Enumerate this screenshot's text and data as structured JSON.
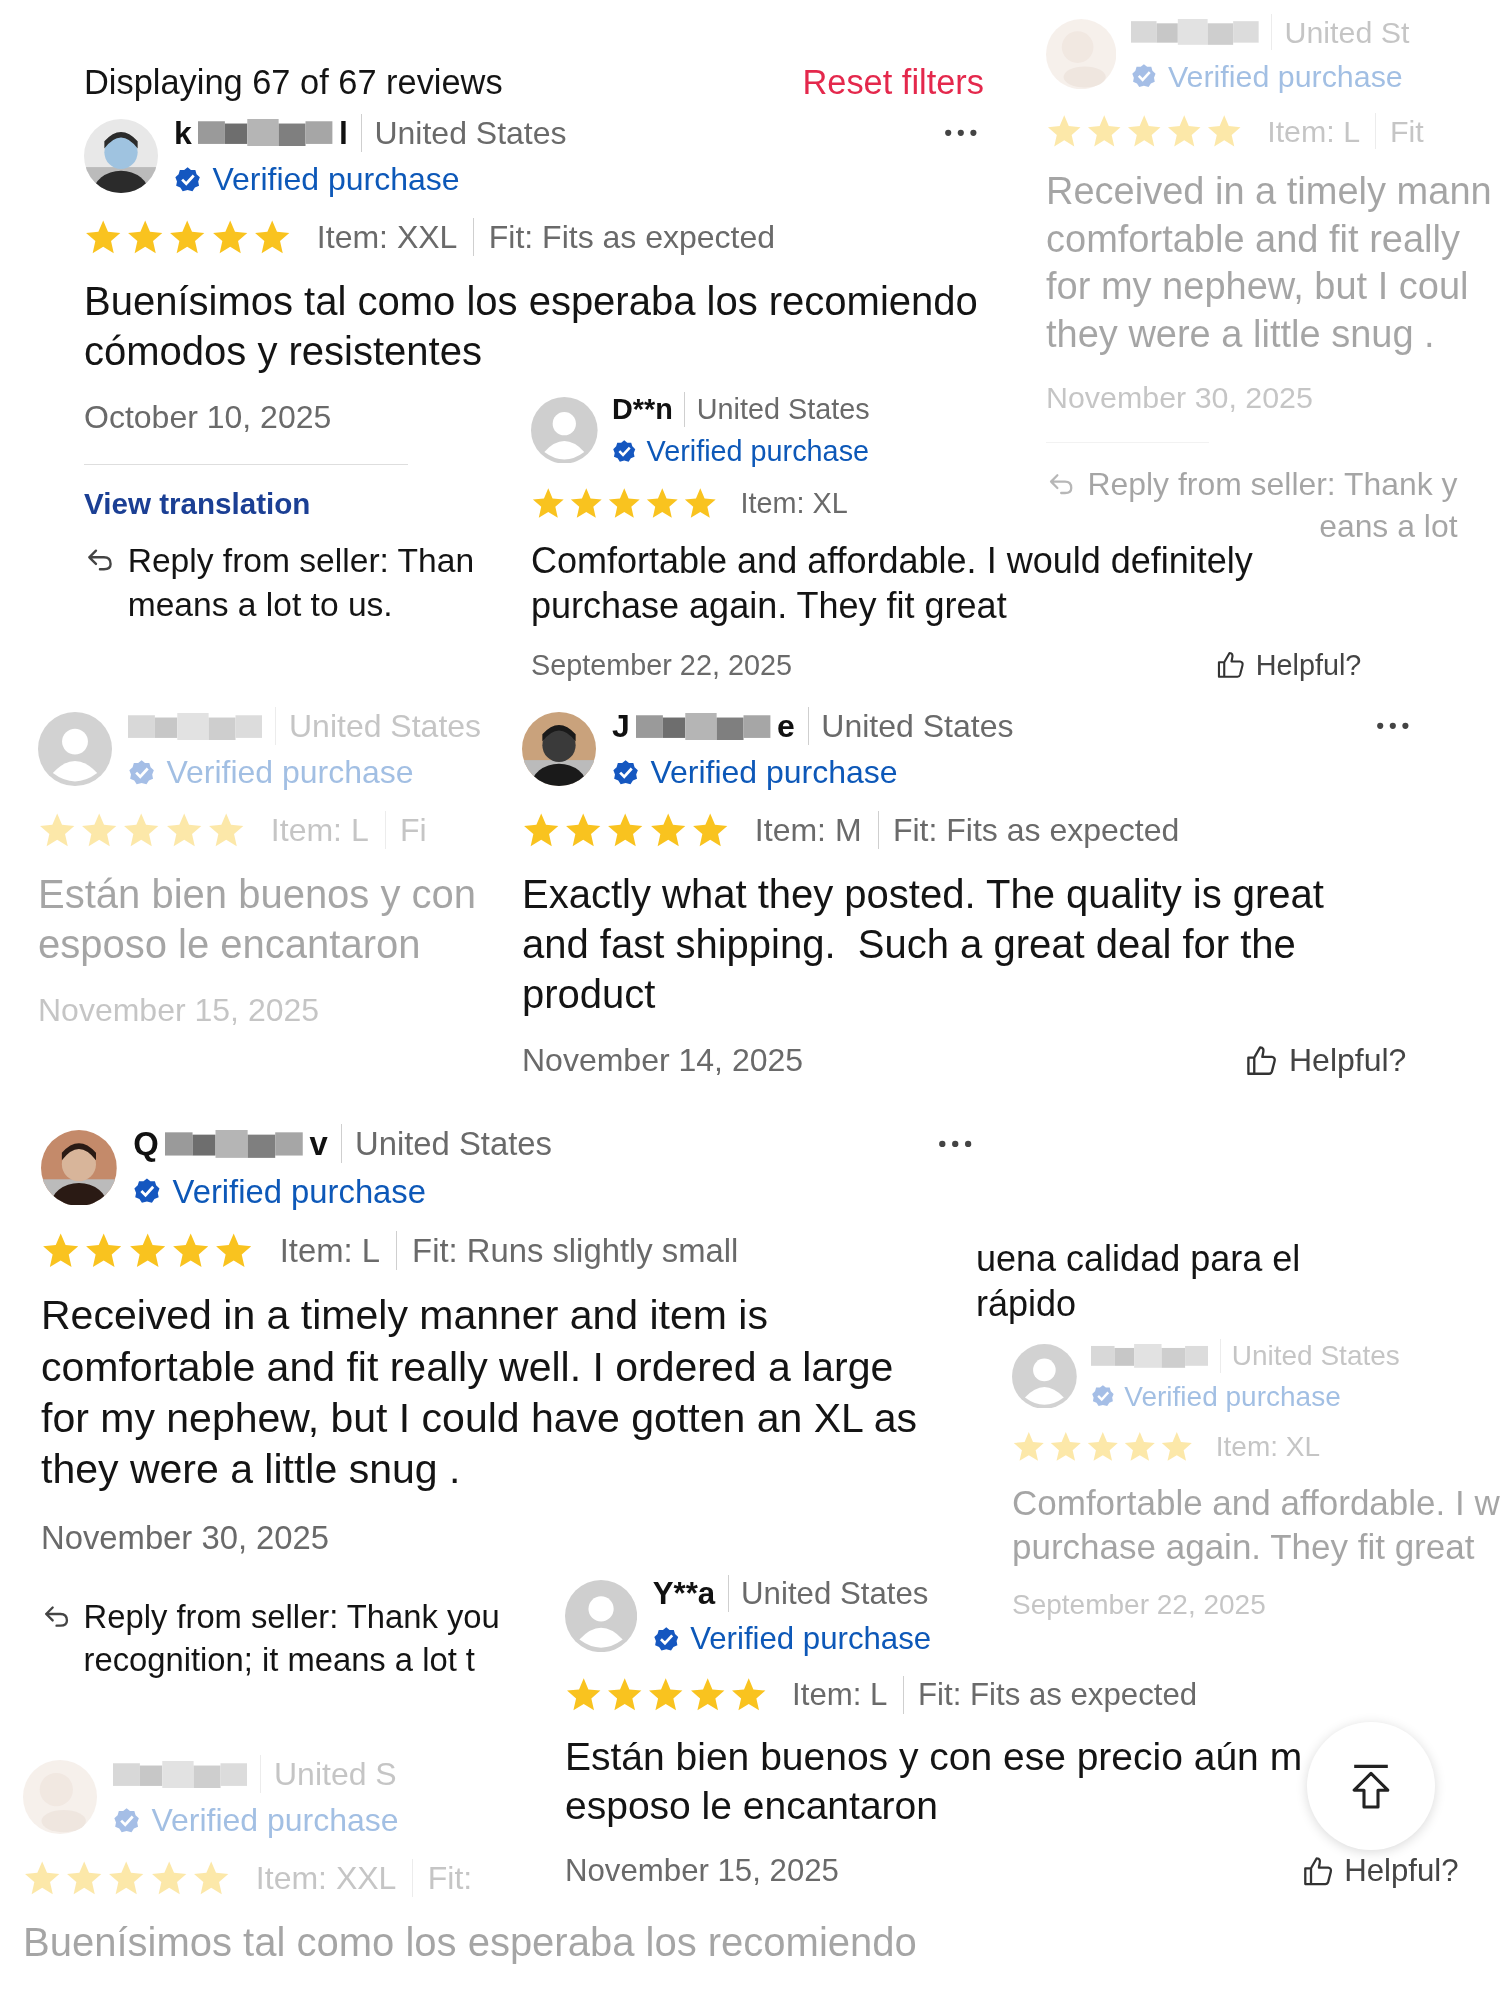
{
  "fragments": [
    {
      "header": {
        "count": "Displaying 67 of 67 reviews",
        "reset": "Reset filters"
      },
      "reviewer": {
        "name_start": "k",
        "name_end": "l",
        "redacted": true,
        "country": "United States",
        "verified": "Verified purchase",
        "more": true
      },
      "stars": 5,
      "item": "Item: XXL",
      "fit": "Fit: Fits as expected",
      "lines": [
        "Buenísimos tal como los esperaba los recomiendo",
        "cómodos y resistentes"
      ],
      "date": "October 10, 2025",
      "translation": "View translation",
      "reply": [
        "Reply from seller: Than",
        "means a lot to us."
      ]
    },
    {
      "reviewer": {
        "name": "D**n",
        "country": "United States",
        "verified": "Verified purchase",
        "avatar": {
          "kind": "placeholder"
        }
      },
      "stars": 5,
      "item": "Item: XL",
      "lines": [
        "Comfortable and affordable. I would definitely",
        "purchase again. They fit great"
      ],
      "date": "September 22, 2025",
      "helpful": "Helpful?"
    },
    {
      "faded": true,
      "reviewer": {
        "redacted": true,
        "country": "United St",
        "verified": "Verified purchase",
        "avatar": {
          "kind": "blurred"
        }
      },
      "stars": 5,
      "item": "Item: L",
      "fit": "Fit",
      "lines": [
        "Received in a timely mann",
        "comfortable and fit really",
        "for my nephew, but I coul",
        "they were a little snug ."
      ],
      "date": "November 30, 2025",
      "reply": [
        "Reply from seller: Thank y",
        "eans a lot"
      ]
    },
    {
      "faded": true,
      "reviewer": {
        "redacted": true,
        "country": "United States",
        "verified": "Verified purchase",
        "avatar": {
          "kind": "placeholder"
        }
      },
      "stars": 5,
      "item": "Item: L",
      "fit": "Fi",
      "lines": [
        "Están bien buenos y con",
        "esposo le encantaron"
      ],
      "date": "November 15, 2025"
    },
    {
      "reviewer": {
        "name_start": "J",
        "name_end": "e",
        "redacted": true,
        "country": "United States",
        "verified": "Verified purchase",
        "more": true
      },
      "stars": 5,
      "item": "Item: M",
      "fit": "Fit: Fits as expected",
      "lines": [
        "Exactly what they posted. The quality is great",
        "and fast shipping.  Such a great deal for the",
        "product"
      ],
      "date": "November 14, 2025",
      "helpful": "Helpful?"
    },
    {
      "reviewer": {
        "name_start": "Q",
        "name_end": "v",
        "redacted": true,
        "country": "United States",
        "verified": "Verified purchase",
        "more": true
      },
      "stars": 5,
      "item": "Item: L",
      "fit": "Fit: Runs slightly small",
      "lines": [
        "Received in a timely manner and item is",
        "comfortable and fit really well. I ordered a large",
        "for my nephew, but I could have gotten an XL as",
        "they were a little snug ."
      ],
      "date": "November 30, 2025"
    },
    {
      "lines": [
        "uena calidad para el",
        "rápido"
      ]
    },
    {
      "reply": [
        "Reply from seller: Thank you",
        "recognition; it means a lot t"
      ]
    },
    {
      "faded": true,
      "reviewer": {
        "redacted": true,
        "country": "United S",
        "verified": "Verified purchase",
        "avatar": {
          "kind": "blurred"
        }
      },
      "stars": 5,
      "item": "Item: XXL",
      "fit": "Fit:",
      "lines": [
        "Buenísimos tal como los esperaba los recomiendo"
      ]
    },
    {
      "faded": true,
      "reviewer": {
        "redacted": true,
        "country": "United States",
        "verified": "Verified purchase",
        "avatar": {
          "kind": "placeholder"
        }
      },
      "stars": 5,
      "item": "Item: XL",
      "lines": [
        "Comfortable and affordable. I w",
        "purchase again. They fit great"
      ],
      "date": "September 22, 2025"
    },
    {
      "reviewer": {
        "name": "Y**a",
        "country": "United States",
        "verified": "Verified purchase",
        "avatar": {
          "kind": "placeholder"
        }
      },
      "stars": 5,
      "item": "Item: L",
      "fit": "Fit: Fits as expected",
      "lines": [
        "Están bien buenos y con ese precio aún m",
        "esposo le encantaron"
      ],
      "date": "November 15, 2025",
      "helpful": "Helpful?"
    }
  ],
  "scroll_to_top": true
}
